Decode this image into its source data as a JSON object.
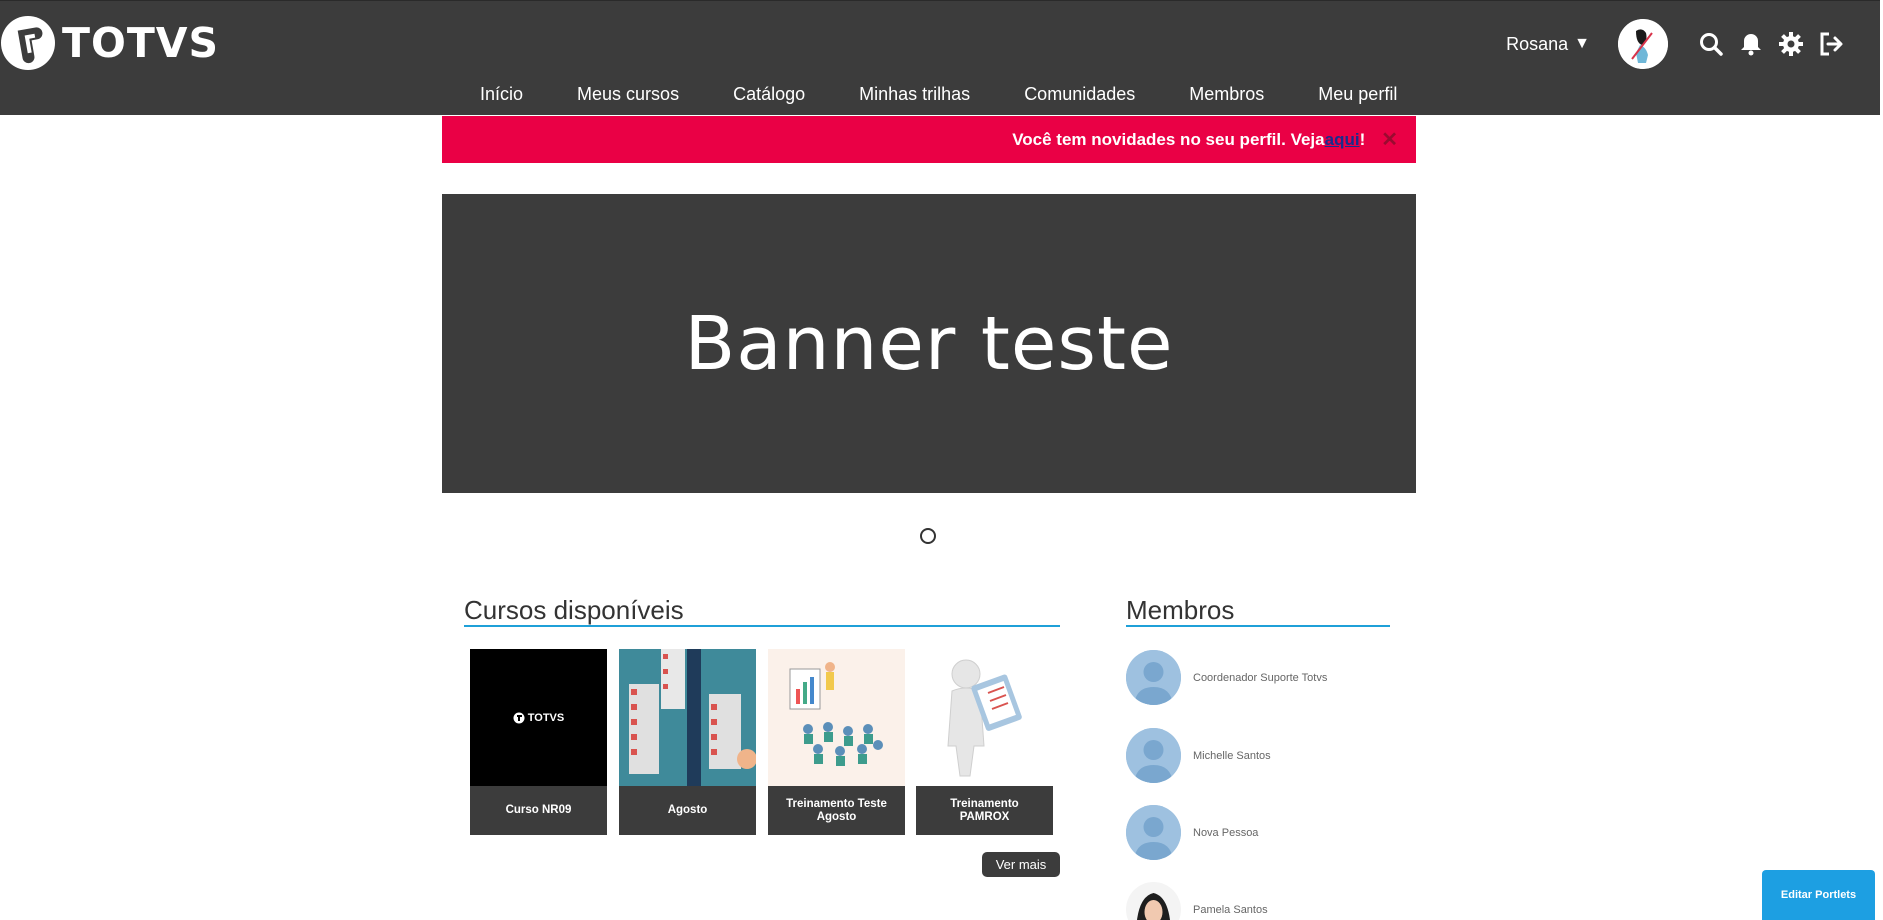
{
  "header": {
    "brand": "TOTVS",
    "user_name": "Rosana",
    "user_caret": "▼",
    "nav": [
      {
        "label": "Início"
      },
      {
        "label": "Meus cursos"
      },
      {
        "label": "Catálogo"
      },
      {
        "label": "Minhas trilhas"
      },
      {
        "label": "Comunidades"
      },
      {
        "label": "Membros"
      },
      {
        "label": "Meu perfil"
      }
    ],
    "icons": [
      "search-icon",
      "bell-icon",
      "gear-icon",
      "logout-icon"
    ]
  },
  "notice": {
    "text": "Você tem novidades no seu perfil. Veja ",
    "link": "aqui",
    "suffix": "!",
    "close": "✕",
    "color": "#ea0045"
  },
  "banner": {
    "title": "Banner teste"
  },
  "courses": {
    "title": "Cursos disponíveis",
    "items": [
      {
        "label": "Curso NR09",
        "thumb_text": "TOTVS"
      },
      {
        "label": "Agosto"
      },
      {
        "label": "Treinamento Teste Agosto"
      },
      {
        "label": "Treinamento PAMROX"
      }
    ],
    "more": "Ver mais"
  },
  "members": {
    "title": "Membros",
    "items": [
      {
        "name": "Coordenador Suporte Totvs"
      },
      {
        "name": "Michelle Santos"
      },
      {
        "name": "Nova Pessoa"
      },
      {
        "name": "Pamela Santos"
      }
    ]
  },
  "edit_portlets": "Editar Portlets",
  "colors": {
    "header_bg": "#3c3c3c",
    "accent_line": "#1fa0d8",
    "edit_button": "#1d9fe2"
  }
}
